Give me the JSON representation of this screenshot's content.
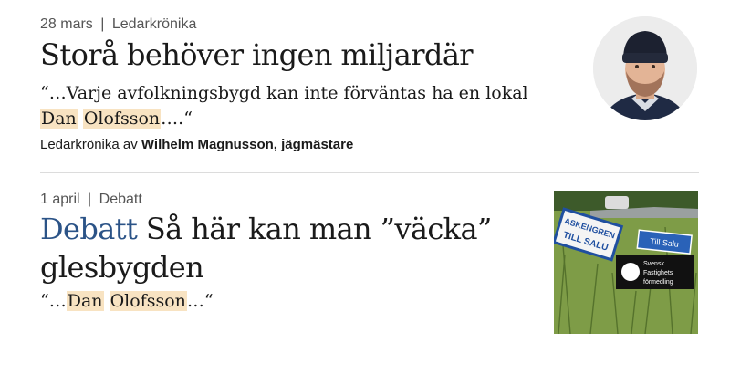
{
  "article1": {
    "date": "28 mars",
    "separator": "|",
    "category": "Ledarkrönika",
    "headline": "Storå behöver ingen miljardär",
    "quote_pre": "“…Varje avfolkningsbygd kan inte förväntas ha en lokal ",
    "quote_hl1": "Dan",
    "quote_mid": " ",
    "quote_hl2": "Olofsson",
    "quote_post": "….“",
    "byline_prefix": "Ledarkrönika av ",
    "byline_author": "Wilhelm Magnusson, jägmästare"
  },
  "article2": {
    "date": "1 april",
    "separator": "|",
    "category": "Debatt",
    "kicker": "Debatt",
    "headline": " Så här kan man ”väcka” glesbygden",
    "quote_pre": "“…",
    "quote_hl1": "Dan",
    "quote_mid": " ",
    "quote_hl2": "Olofsson",
    "quote_post": "…“",
    "image_signs": {
      "sign1_line1": "ASKENGREN",
      "sign1_line2": "TILL SALU",
      "sign2": "Till Salu",
      "sign3_line1": "Svensk",
      "sign3_line2": "Fastighets",
      "sign3_line3": "förmedling"
    }
  },
  "colors": {
    "kicker": "#2b5387",
    "highlight": "#f8e3c2",
    "meta": "#555555",
    "divider": "#dcdcdc"
  }
}
